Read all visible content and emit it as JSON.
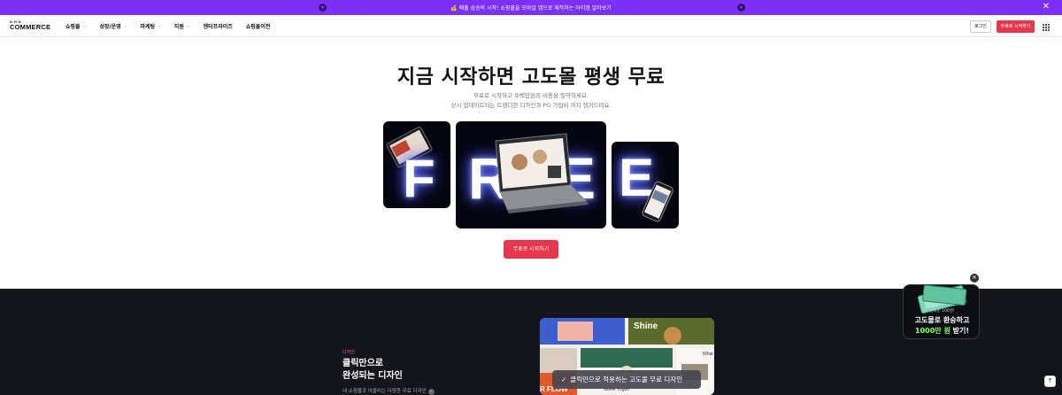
{
  "promo": {
    "text": "💰 매출 상승의 시작! 쇼핑몰을 모바일 앱으로 제작하는 아이엠 알아보기",
    "prev_icon": "chevron-left-icon",
    "next_icon": "chevron-right-icon",
    "close_icon": "close-icon",
    "bg_color": "#7b2ff7"
  },
  "nav": {
    "logo_top": "NHN",
    "logo_main": "COMMERCE",
    "items": [
      {
        "label": "쇼핑몰",
        "dropdown": true
      },
      {
        "label": "성장/운영",
        "dropdown": true
      },
      {
        "label": "마케팅",
        "dropdown": true
      },
      {
        "label": "지원",
        "dropdown": true
      },
      {
        "label": "엔터프라이즈",
        "dropdown": false
      },
      {
        "label": "쇼핑몰이전",
        "dropdown": false
      }
    ],
    "login_label": "로그인",
    "start_label": "무료로 시작하기",
    "apps_icon": "grid-icon",
    "accent_color": "#e8374c"
  },
  "hero": {
    "title": "지금 시작하면 고도몰 평생 무료",
    "sub_line1": "무료로 시작하고 수백만원의 비용을 절약하세요.",
    "sub_line2": "상시 업데이트되는 트렌디한 디자인과 PG 가입비 까지 챙겨드려요.",
    "glow_letters": [
      "F",
      "R",
      "E",
      "E"
    ],
    "cta_label": "무료로 시작하기"
  },
  "design_section": {
    "tag": "디자인",
    "title_line1": "클릭만으로",
    "title_line2": "완성되는 디자인",
    "desc": "내 쇼핑몰과 어울리는 다양한 무료 디자인",
    "mosaic_text1": "Shine",
    "mosaic_text2": "R FLOW",
    "mosaic_text3": "Greek Yogurt",
    "mosaic_text4": "What",
    "toast": "클릭만으로 적용하는 고도몰 무료 디자인"
  },
  "widget": {
    "small": "선착순 100명!",
    "line1": "고도몰로 환승하고",
    "highlight": "1000만 원",
    "line2_suffix": " 받기!",
    "highlight_color": "#8cff5a"
  },
  "scroll_top_icon": "arrow-up-icon"
}
